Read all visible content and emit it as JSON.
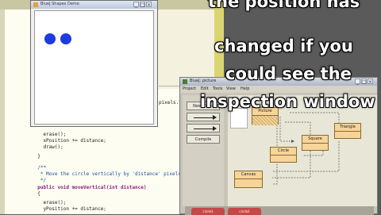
{
  "editor": {
    "lines": [
      "",
      "",
      "",
      "",
      "",
      "",
      "",
      "",
      "",
      "",
      "",
      "",
      "",
      "",
      "",
      "",
      "    erase();",
      "    xPosition += distance;",
      "    draw();",
      "  }",
      "",
      "  /**",
      "   * Move the circle vertically by 'distance' pixels.",
      "   */",
      "  public void moveVertical(int distance)",
      "  {",
      "    erase();",
      "    yPosition += distance;"
    ],
    "pixels_fragment": "pixels."
  },
  "canvas_window": {
    "title": "BlueJ Shapes Demo",
    "min": "_",
    "max": "□",
    "close": "×",
    "circles": 2
  },
  "bluej_window": {
    "title": "BlueJ: picture",
    "menus": [
      "Project",
      "Edit",
      "Tools",
      "View",
      "Help"
    ],
    "buttons": {
      "new_class": "New Class",
      "compile": "Compile"
    },
    "classes": {
      "picture": "Picture",
      "triangle": "Triangle",
      "square": "Square",
      "circle": "Circle",
      "canvas": "Canvas"
    },
    "bench_objects": [
      "circle1",
      "circle2"
    ]
  },
  "overlay": {
    "line1": "the position has",
    "line2": "changed if you",
    "line3": "could see the",
    "line4": "inspection window"
  }
}
